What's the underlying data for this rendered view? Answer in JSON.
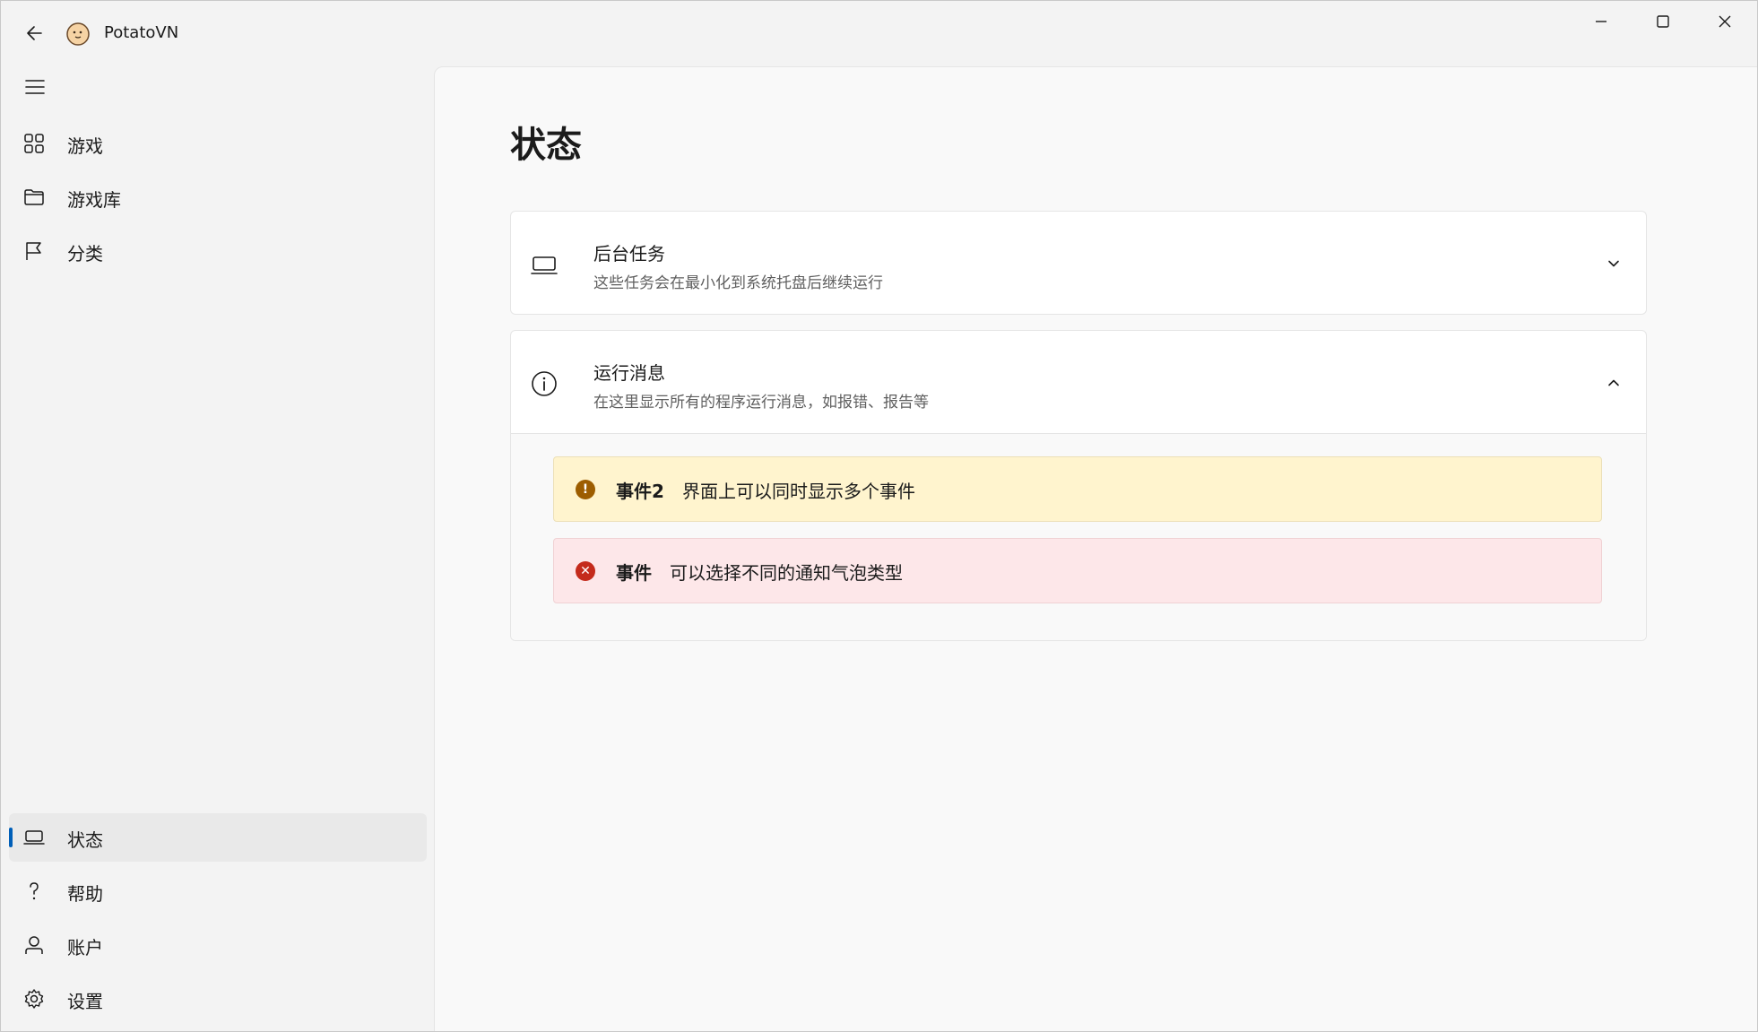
{
  "app": {
    "title": "PotatoVN"
  },
  "window_controls": {
    "minimize_icon": "minimize-icon",
    "maximize_icon": "maximize-icon",
    "close_icon": "close-icon"
  },
  "sidebar": {
    "top_items": [
      {
        "label": "游戏",
        "icon": "grid-icon"
      },
      {
        "label": "游戏库",
        "icon": "folder-icon"
      },
      {
        "label": "分类",
        "icon": "flag-icon"
      }
    ],
    "bottom_items": [
      {
        "label": "状态",
        "icon": "laptop-icon",
        "selected": true
      },
      {
        "label": "帮助",
        "icon": "question-icon"
      },
      {
        "label": "账户",
        "icon": "person-icon"
      },
      {
        "label": "设置",
        "icon": "gear-icon"
      }
    ],
    "accent_color": "#005fb8"
  },
  "page": {
    "title": "状态",
    "background_tasks": {
      "title": "后台任务",
      "description": "这些任务会在最小化到系统托盘后继续运行",
      "expanded": false
    },
    "run_messages": {
      "title": "运行消息",
      "description": "在这里显示所有的程序运行消息，如报错、报告等",
      "expanded": true,
      "events": [
        {
          "severity": "warning",
          "title": "事件2",
          "message": "界面上可以同时显示多个事件",
          "color": "#fff4ce"
        },
        {
          "severity": "error",
          "title": "事件",
          "message": "可以选择不同的通知气泡类型",
          "color": "#fde7e9"
        }
      ]
    }
  }
}
